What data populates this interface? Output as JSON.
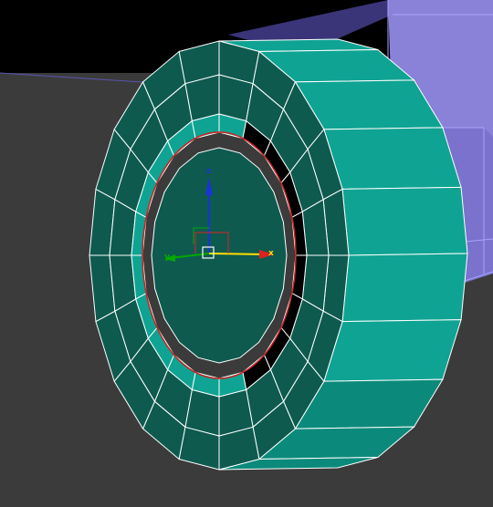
{
  "viewport": {
    "background": "#3a3a3a",
    "selection_color": "#ffffff"
  },
  "wheel": {
    "fill_main": "#0e5a4f",
    "fill_rim": "#0fa393",
    "fill_rim_dark": "#0b8a7b",
    "fill_hole": "#000000",
    "edge_color": "#ffffff",
    "inner_ring_color": "#cc2222"
  },
  "body_block": {
    "fill_front": "#8a82d8",
    "fill_side": "#5b55b0",
    "edge_color": "#a8a4ff"
  },
  "gizmo": {
    "x_label": "x",
    "y_label": "y",
    "z_label": "z",
    "x_color": "#ffdd00",
    "y_color": "#00aa00",
    "z_color": "#1a34d6",
    "x_tip_color": "#dd2222",
    "center_icon": "gizmo-center-square"
  }
}
